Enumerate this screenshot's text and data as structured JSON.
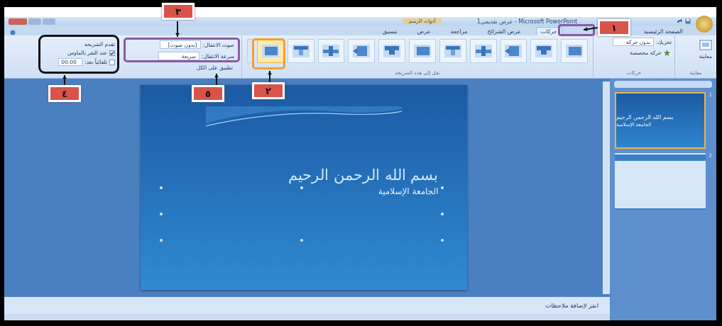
{
  "window": {
    "title": "عرض تقديمي1 - Microsoft PowerPoint",
    "context_tab": "أدوات الرسم"
  },
  "tabs": [
    {
      "label": "الصفحة الرئيسية",
      "selected": false
    },
    {
      "label": "حركات",
      "selected": true
    },
    {
      "label": "عرض الشرائح",
      "selected": false
    },
    {
      "label": "مراجعة",
      "selected": false
    },
    {
      "label": "عرض",
      "selected": false
    },
    {
      "label": "تنسيق",
      "selected": false
    }
  ],
  "ribbon": {
    "preview": {
      "label": "معاينة",
      "group": "معاينة"
    },
    "animations": {
      "animate_label": "تحريك:",
      "animate_value": "بدون حركة",
      "custom": "حركة مخصصة",
      "group": "حركات"
    },
    "transitions": {
      "group": "نقل إلى هذه الشريحة",
      "items": [
        {
          "selected": false
        },
        {
          "selected": false
        },
        {
          "selected": false
        },
        {
          "selected": false
        },
        {
          "selected": false
        },
        {
          "selected": false
        },
        {
          "selected": false
        },
        {
          "selected": false
        },
        {
          "selected": false
        },
        {
          "selected": false
        },
        {
          "selected": true
        }
      ]
    },
    "options": {
      "sound_label": "صوت الانتقال:",
      "sound_value": "[بدون صوت]",
      "speed_label": "سرعة الانتقال:",
      "speed_value": "سريعة",
      "apply_all": "تطبيق على الكل"
    },
    "advance": {
      "title": "تقدم الشريحة",
      "on_click": {
        "label": "عند النقر بالماوس",
        "checked": true
      },
      "after": {
        "label": "تلقائياً بعد:",
        "checked": false,
        "value": "00:00"
      }
    }
  },
  "slide": {
    "title": "بسم الله الرحمن الرحيم",
    "subtitle": "الجامعة الإسلامية"
  },
  "slides": [
    {
      "number": "1",
      "title": "بسم الله الرحمن الرحيم",
      "subtitle": "الجامعة الإسلامية",
      "selected": true
    },
    {
      "number": "2",
      "selected": false
    }
  ],
  "notes": {
    "placeholder": "انقر لإضافة ملاحظات"
  },
  "callouts": [
    {
      "label": "٣"
    },
    {
      "label": "١"
    },
    {
      "label": "٢"
    },
    {
      "label": "٥"
    },
    {
      "label": "٤"
    }
  ]
}
